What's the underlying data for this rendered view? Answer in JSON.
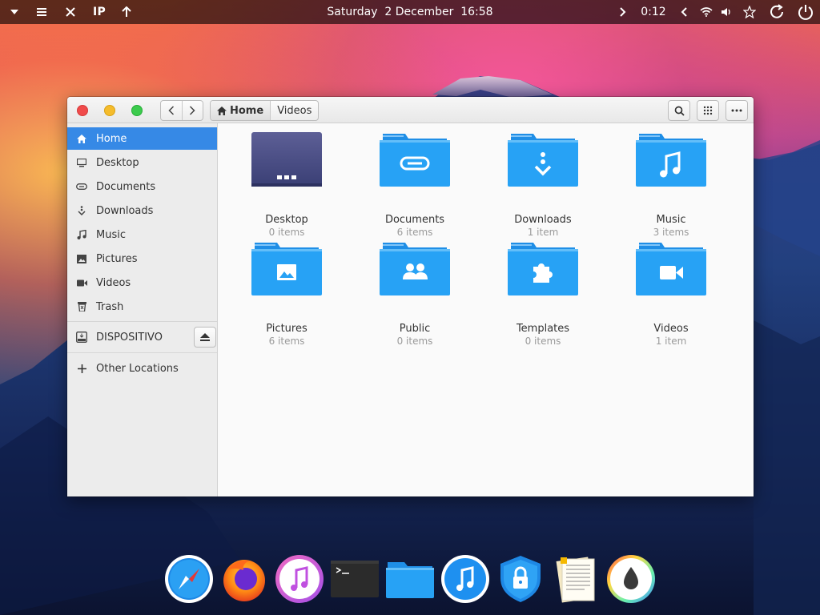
{
  "topbar": {
    "left_items": [
      "IP"
    ],
    "clock": "Saturday  2 December  16:58",
    "timer": "0:12"
  },
  "window": {
    "breadcrumbs": [
      "Home",
      "Videos"
    ]
  },
  "sidebar": {
    "items": [
      {
        "label": "Home",
        "icon": "home-icon",
        "active": true
      },
      {
        "label": "Desktop",
        "icon": "desktop-icon"
      },
      {
        "label": "Documents",
        "icon": "documents-icon"
      },
      {
        "label": "Downloads",
        "icon": "downloads-icon"
      },
      {
        "label": "Music",
        "icon": "music-icon"
      },
      {
        "label": "Pictures",
        "icon": "pictures-icon"
      },
      {
        "label": "Videos",
        "icon": "videos-icon"
      },
      {
        "label": "Trash",
        "icon": "trash-icon"
      }
    ],
    "device": {
      "label": "DISPOSITIVO",
      "icon": "drive-icon"
    },
    "other": {
      "label": "Other Locations",
      "icon": "plus-icon"
    }
  },
  "content": {
    "folders": [
      {
        "name": "Desktop",
        "count": "0 items",
        "icon": "desktop-folder-icon"
      },
      {
        "name": "Documents",
        "count": "6 items",
        "icon": "documents-folder-icon"
      },
      {
        "name": "Downloads",
        "count": "1 item",
        "icon": "downloads-folder-icon"
      },
      {
        "name": "Music",
        "count": "3 items",
        "icon": "music-folder-icon"
      },
      {
        "name": "Pictures",
        "count": "6 items",
        "icon": "pictures-folder-icon"
      },
      {
        "name": "Public",
        "count": "0 items",
        "icon": "public-folder-icon"
      },
      {
        "name": "Templates",
        "count": "0 items",
        "icon": "templates-folder-icon"
      },
      {
        "name": "Videos",
        "count": "1 item",
        "icon": "videos-folder-icon"
      }
    ]
  },
  "dock": {
    "apps": [
      "safari-icon",
      "firefox-icon",
      "itunes-icon",
      "terminal-icon",
      "files-icon",
      "music-player-icon",
      "vpn-lock-icon",
      "text-editor-icon",
      "color-drop-icon"
    ]
  },
  "colors": {
    "accent": "#3689e6",
    "folder_blue": "#2a9df4",
    "topbar_bg": "#1a1a1a"
  }
}
